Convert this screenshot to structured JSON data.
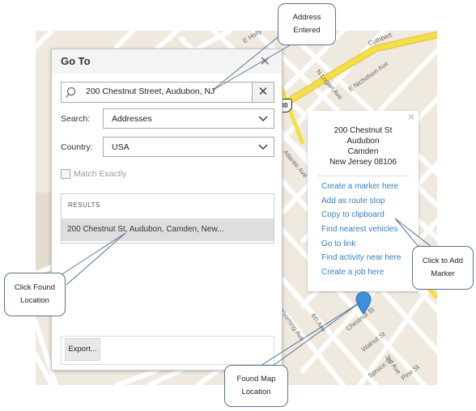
{
  "dialog": {
    "title": "Go To",
    "close_glyph": "✕",
    "search_value": "200 Chestnut Street, Audubon, NJ",
    "clear_glyph": "✕",
    "search_label": "Search:",
    "search_type": "Addresses",
    "country_label": "Country:",
    "country": "USA",
    "match_exactly": "Match Exactly",
    "results_header": "RESULTS",
    "result_row": "200 Chestnut St, Audubon, Camden, New...",
    "export_label": "Export..."
  },
  "popup": {
    "close_glyph": "✕",
    "address": {
      "line1": "200 Chestnut St",
      "line2": "Audubon",
      "line3": "Camden",
      "line4": "New Jersey 08106"
    },
    "actions": [
      "Create a marker here",
      "Add as route stop",
      "Copy to clipboard",
      "Find nearest vehicles",
      "Go to link",
      "Find activity near here",
      "Create a job here"
    ]
  },
  "map": {
    "street_labels": [
      "E Holly",
      "Cuthbert",
      "N Logan Ave",
      "E Nicholson Ave",
      "Atlantic Ave",
      "Wyoming Ave",
      "4th Ave",
      "3rd Ave",
      "Chestnut St",
      "Walnut St",
      "Spruce St",
      "Pine St"
    ],
    "route_shield": "30"
  },
  "callouts": {
    "address_entered": {
      "line1": "Address",
      "line2": "Entered"
    },
    "click_found": {
      "line1": "Click Found",
      "line2": "Location"
    },
    "click_add": {
      "line1": "Click to Add",
      "line2": "Marker"
    },
    "found_map": {
      "line1": "Found Map",
      "line2": "Location"
    }
  },
  "colors": {
    "link": "#3a7fbf",
    "marker": "#3d8fe0",
    "highway": "#f4df45",
    "map_bg": "#efe9df"
  },
  "icons": {
    "search": "magnifier-icon",
    "chevron": "chevron-down-icon",
    "marker": "map-pin-icon"
  }
}
